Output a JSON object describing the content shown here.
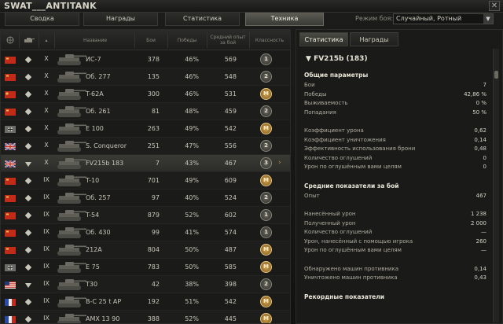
{
  "window": {
    "title": "SWAT___ANTITANK",
    "close": "✕"
  },
  "tabs": [
    {
      "label": "Сводка"
    },
    {
      "label": "Награды"
    },
    {
      "label": "Статистика"
    },
    {
      "label": "Техника",
      "active": true
    }
  ],
  "mode": {
    "label": "Режим боя:",
    "value": "Случайный, Ротный"
  },
  "table": {
    "headers": {
      "name": "Название",
      "battles": "Бои",
      "wins": "Победы",
      "avg_xp": "Средний опыт за бой",
      "mastery": "Классность"
    },
    "rows": [
      {
        "flag": "ussr",
        "type": "diamond",
        "tier": "X",
        "name": "ИС-7",
        "battles": "378",
        "wins": "46%",
        "xp": "569",
        "badge": "1"
      },
      {
        "flag": "ussr",
        "type": "diamond",
        "tier": "X",
        "name": "Об. 277",
        "battles": "135",
        "wins": "46%",
        "xp": "548",
        "badge": "2"
      },
      {
        "flag": "china",
        "type": "diamond",
        "tier": "X",
        "name": "T-62A",
        "battles": "300",
        "wins": "46%",
        "xp": "531",
        "badge": "M"
      },
      {
        "flag": "ussr",
        "type": "diamond",
        "tier": "X",
        "name": "Об. 261",
        "battles": "81",
        "wins": "48%",
        "xp": "459",
        "badge": "2"
      },
      {
        "flag": "germany",
        "type": "diamond",
        "tier": "X",
        "name": "E 100",
        "battles": "263",
        "wins": "49%",
        "xp": "542",
        "badge": "M"
      },
      {
        "flag": "uk",
        "type": "diamond",
        "tier": "X",
        "name": "S. Conqueror",
        "battles": "251",
        "wins": "47%",
        "xp": "556",
        "badge": "2"
      },
      {
        "flag": "uk",
        "type": "tri",
        "tier": "X",
        "name": "FV215b 183",
        "battles": "7",
        "wins": "43%",
        "xp": "467",
        "badge": "3",
        "selected": true
      },
      {
        "flag": "ussr",
        "type": "diamond",
        "tier": "IX",
        "name": "T-10",
        "battles": "701",
        "wins": "49%",
        "xp": "609",
        "badge": "M"
      },
      {
        "flag": "ussr",
        "type": "diamond",
        "tier": "IX",
        "name": "Об. 257",
        "battles": "97",
        "wins": "40%",
        "xp": "524",
        "badge": "2"
      },
      {
        "flag": "ussr",
        "type": "diamond",
        "tier": "IX",
        "name": "T-54",
        "battles": "879",
        "wins": "52%",
        "xp": "602",
        "badge": "1"
      },
      {
        "flag": "ussr",
        "type": "diamond",
        "tier": "IX",
        "name": "Об. 430",
        "battles": "99",
        "wins": "41%",
        "xp": "574",
        "badge": "1"
      },
      {
        "flag": "ussr",
        "type": "diamond",
        "tier": "IX",
        "name": "212A",
        "battles": "804",
        "wins": "50%",
        "xp": "487",
        "badge": "M"
      },
      {
        "flag": "germany",
        "type": "diamond",
        "tier": "IX",
        "name": "E 75",
        "battles": "783",
        "wins": "50%",
        "xp": "585",
        "badge": "M"
      },
      {
        "flag": "usa",
        "type": "tri",
        "tier": "IX",
        "name": "T30",
        "battles": "42",
        "wins": "38%",
        "xp": "398",
        "badge": "2"
      },
      {
        "flag": "france",
        "type": "diamond",
        "tier": "IX",
        "name": "B-C 25 t AP",
        "battles": "192",
        "wins": "51%",
        "xp": "542",
        "badge": "M"
      },
      {
        "flag": "france",
        "type": "diamond",
        "tier": "IX",
        "name": "AMX 13 90",
        "battles": "388",
        "wins": "52%",
        "xp": "445",
        "badge": "M"
      }
    ]
  },
  "right": {
    "tabs": [
      {
        "label": "Статистика",
        "active": true
      },
      {
        "label": "Награды"
      }
    ],
    "tank_title": "FV215b (183)",
    "sections": [
      {
        "title": "Общие параметры",
        "items": [
          [
            "Бои",
            "7"
          ],
          [
            "Победы",
            "42,86 %"
          ],
          [
            "Выживаемость",
            "0 %"
          ],
          [
            "Попадания",
            "50 %"
          ]
        ]
      },
      {
        "title": "",
        "items": [
          [
            "Коэффициент урона",
            "0,62"
          ],
          [
            "Коэффициент уничтожения",
            "0,14"
          ],
          [
            "Эффективность использования брони",
            "0,48"
          ],
          [
            "Количество оглушений",
            "0"
          ],
          [
            "Урон по оглушённым вами целям",
            "0"
          ]
        ]
      },
      {
        "title": "Средние показатели за бой",
        "items": [
          [
            "Опыт",
            "467"
          ]
        ]
      },
      {
        "title": "",
        "items": [
          [
            "Нанесённый урон",
            "1 238"
          ],
          [
            "Полученный урон",
            "2 000"
          ],
          [
            "Количество оглушений",
            "—"
          ],
          [
            "Урон, нанесённый с помощью игрока",
            "260"
          ],
          [
            "Урон по оглушённым вами целям",
            "—"
          ]
        ]
      },
      {
        "title": "",
        "items": [
          [
            "Обнаружено машин противника",
            "0,14"
          ],
          [
            "Уничтожено машин противника",
            "0,43"
          ]
        ]
      },
      {
        "title": "Рекордные показатели",
        "items": []
      }
    ]
  },
  "colors": {
    "accent": "#d08a2c",
    "panel": "#1a1a19"
  }
}
